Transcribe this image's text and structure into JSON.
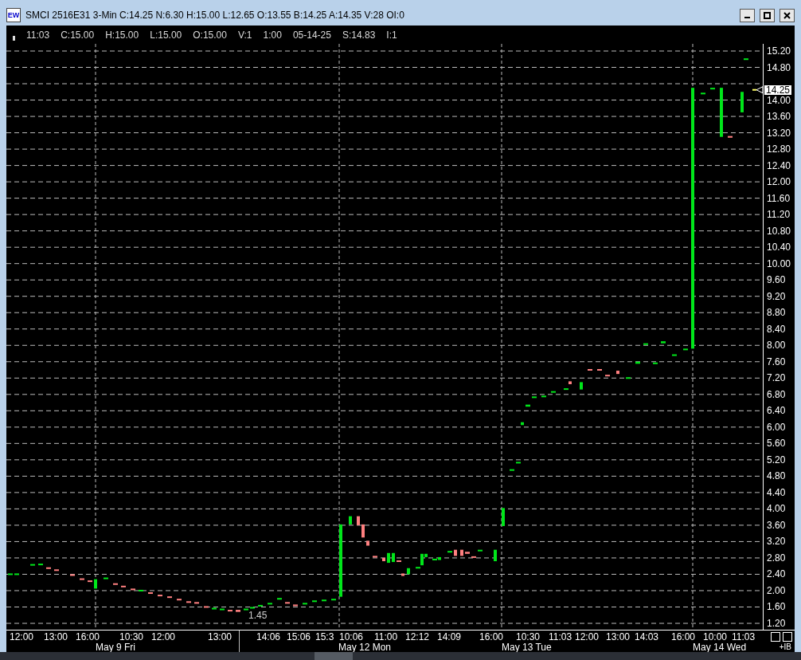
{
  "window": {
    "title": "SMCI 2516E31 3-Min C:14.25 N:6.30 H:15.00 L:12.65 O:13.55 B:14.25 A:14.35 V:28 OI:0",
    "app_icon_text": "EW"
  },
  "info_bar": [
    "11:03",
    "C:15.00",
    "H:15.00",
    "L:15.00",
    "O:15.00",
    "V:1",
    "1:00",
    "05-14-25",
    "S:14.83",
    "I:1"
  ],
  "price_axis": {
    "labels": [
      "15.20",
      "14.80",
      "14.00",
      "13.60",
      "13.20",
      "12.80",
      "12.40",
      "12.00",
      "11.60",
      "11.20",
      "10.80",
      "10.40",
      "10.00",
      "9.60",
      "9.20",
      "8.80",
      "8.40",
      "8.00",
      "7.60",
      "7.20",
      "6.80",
      "6.40",
      "6.00",
      "5.60",
      "5.20",
      "4.80",
      "4.40",
      "4.00",
      "3.60",
      "3.20",
      "2.80",
      "2.40",
      "2.00",
      "1.60",
      "1.20"
    ],
    "last_price": "14.25"
  },
  "low_label": "1.45",
  "time_axis": {
    "times": [
      "12:00",
      "13:00",
      "16:00",
      "10:30",
      "12:00",
      "13:00",
      "14:06",
      "15:06",
      "15:3",
      "10:06",
      "11:00",
      "12:12",
      "14:09",
      "16:00",
      "10:30",
      "11:03",
      "12:00",
      "13:00",
      "14:03",
      "16:00",
      "10:00",
      "11:03"
    ],
    "dates": [
      "May 9 Fri",
      "May 12 Mon",
      "May 13 Tue",
      "May 14 Wed"
    ]
  },
  "corner_label": "+IB"
}
